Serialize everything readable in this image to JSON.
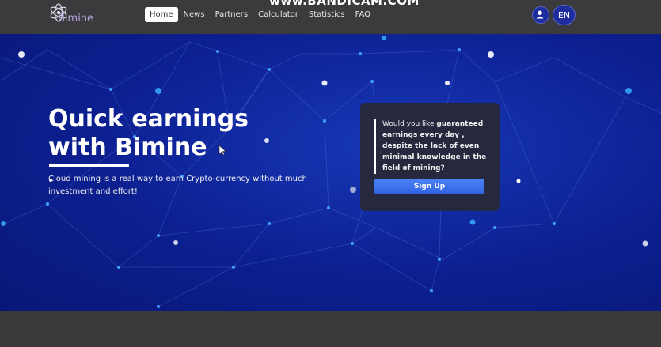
{
  "watermark": "www.BANDICAM.COM",
  "brand": {
    "name": "Bimine"
  },
  "nav": {
    "items": [
      {
        "label": "Home",
        "active": true
      },
      {
        "label": "News",
        "active": false
      },
      {
        "label": "Partners",
        "active": false
      },
      {
        "label": "Calculator",
        "active": false
      },
      {
        "label": "Statistics",
        "active": false
      },
      {
        "label": "FAQ",
        "active": false
      }
    ]
  },
  "header": {
    "user_icon": "user-icon",
    "language": "EN"
  },
  "hero": {
    "title": "Quick earnings with Bimine",
    "subtitle": "Cloud mining is a real way to earn Crypto-currency without much investment and effort!"
  },
  "card": {
    "text_parts": [
      {
        "text": "Would you like ",
        "bold": false
      },
      {
        "text": "guaranteed earnings every day , despite the lack of even minimal knowledge in the field of mining?",
        "bold": true
      }
    ],
    "button_label": "Sign Up"
  },
  "colors": {
    "navbar": "#3b3b3e",
    "hero": "#0c1f8f",
    "accent_button": "#3a6ff0",
    "lang_button": "#1e2c9e"
  }
}
